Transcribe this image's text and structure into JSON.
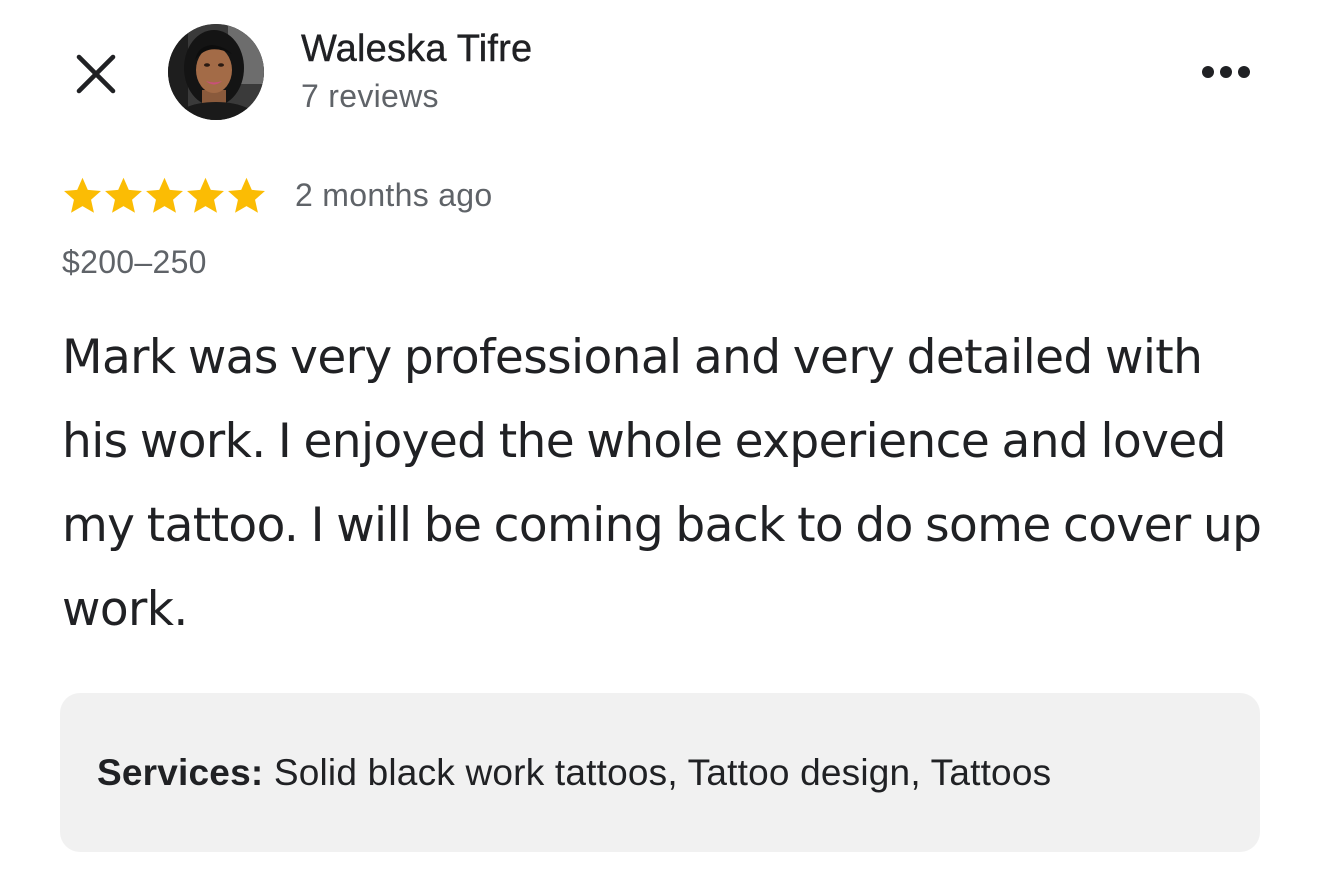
{
  "header": {
    "close_icon": "close-icon",
    "reviewer_name": "Waleska Tifre",
    "review_count": "7 reviews",
    "more_icon": "more-options-icon"
  },
  "review": {
    "rating": 5,
    "rating_max": 5,
    "star_color": "#fbbc04",
    "time": "2 months ago",
    "price": "$200–250",
    "text": "Mark was very professional and very detailed with his work. I enjoyed the whole experience and loved my tattoo. I will be coming back to do some cover up work."
  },
  "services": {
    "label": "Services:",
    "value": "Solid black work tattoos, Tattoo design, Tattoos"
  }
}
